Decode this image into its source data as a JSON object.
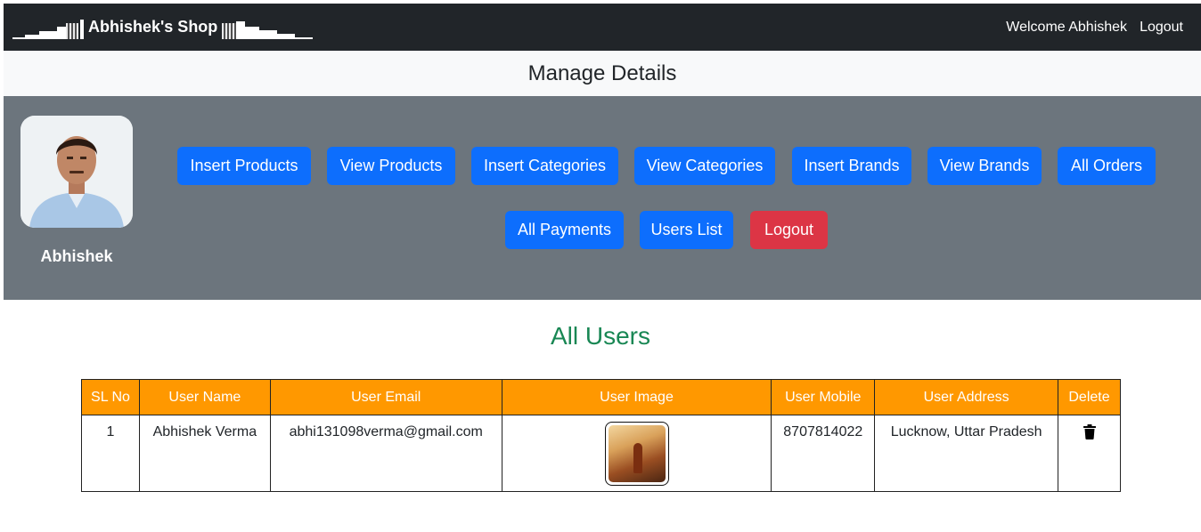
{
  "navbar": {
    "brand": "Abhishek's Shop",
    "welcome": "Welcome Abhishek",
    "logout": "Logout"
  },
  "header": {
    "title": "Manage Details"
  },
  "profile": {
    "name": "Abhishek"
  },
  "buttons": {
    "insert_products": "Insert Products",
    "view_products": "View Products",
    "insert_categories": "Insert Categories",
    "view_categories": "View Categories",
    "insert_brands": "Insert Brands",
    "view_brands": "View Brands",
    "all_orders": "All Orders",
    "all_payments": "All Payments",
    "users_list": "Users List",
    "logout": "Logout"
  },
  "section": {
    "title": "All Users"
  },
  "table": {
    "headers": [
      "SL No",
      "User Name",
      "User Email",
      "User Image",
      "User Mobile",
      "User Address",
      "Delete"
    ],
    "rows": [
      {
        "sl": "1",
        "name": "Abhishek Verma",
        "email": "abhi131098verma@gmail.com",
        "mobile": "8707814022",
        "address": "Lucknow, Uttar Pradesh"
      }
    ]
  },
  "colors": {
    "navbar": "#212529",
    "primary": "#0d6efd",
    "danger": "#dc3545",
    "panel": "#6c757d",
    "table_header": "#ff9800",
    "success": "#198754"
  },
  "icons": {
    "delete": "trash-icon"
  }
}
